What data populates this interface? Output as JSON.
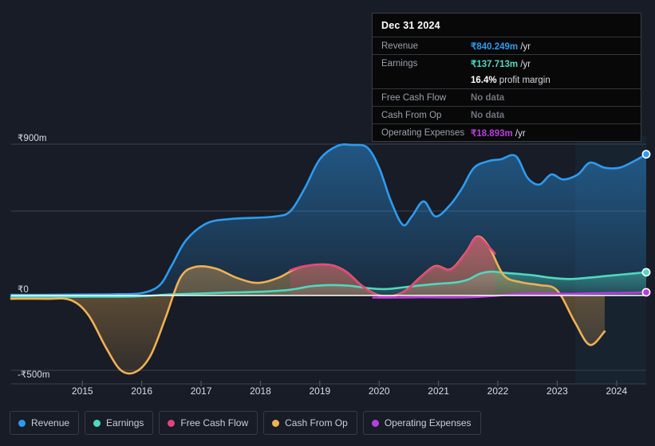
{
  "background_color": "#171c26",
  "tooltip": {
    "title": "Dec 31 2024",
    "rows": [
      {
        "key": "Revenue",
        "value": "₹840.249m",
        "unit": "/yr",
        "color": "#2e9bf0",
        "nodata": false
      },
      {
        "key": "Earnings",
        "value": "₹137.713m",
        "unit": "/yr",
        "color": "#4fd9c0",
        "nodata": false
      },
      {
        "key": "",
        "value": "16.4%",
        "unit": "profit margin",
        "color": "#ffffff",
        "nodata": false
      },
      {
        "key": "Free Cash Flow",
        "value": "No data",
        "unit": "",
        "color": "#6f747d",
        "nodata": true
      },
      {
        "key": "Cash From Op",
        "value": "No data",
        "unit": "",
        "color": "#6f747d",
        "nodata": true
      },
      {
        "key": "Operating Expenses",
        "value": "₹18.893m",
        "unit": "/yr",
        "color": "#b93ee0",
        "nodata": false
      }
    ]
  },
  "legend": {
    "items": [
      {
        "label": "Revenue",
        "color": "#2e9bf0"
      },
      {
        "label": "Earnings",
        "color": "#4fd9c0"
      },
      {
        "label": "Free Cash Flow",
        "color": "#e0457b"
      },
      {
        "label": "Cash From Op",
        "color": "#f0b055"
      },
      {
        "label": "Operating Expenses",
        "color": "#b93ee0"
      }
    ]
  },
  "chart_data": {
    "type": "area",
    "title": "",
    "xlabel": "",
    "ylabel": "",
    "currency": "₹",
    "units": "m",
    "grid": true,
    "legend_position": "bottom",
    "x_ticks": [
      "2015",
      "2016",
      "2017",
      "2018",
      "2019",
      "2020",
      "2021",
      "2022",
      "2023",
      "2024"
    ],
    "y_ticks": [
      "₹900m",
      "₹0",
      "-₹500m"
    ],
    "y_tick_values": [
      900,
      0,
      -500
    ],
    "ylim": [
      -560,
      960
    ],
    "xlim": [
      2014.3,
      2025.0
    ],
    "highlight_band": {
      "from": 2023.8,
      "to": 2025.0
    },
    "series": [
      {
        "name": "Revenue",
        "color": "#2e9bf0",
        "fill": true,
        "end_marker": true,
        "x": [
          2014.3,
          2014.8,
          2015.2,
          2015.7,
          2016.1,
          2016.5,
          2016.8,
          2017.0,
          2017.25,
          2017.6,
          2018.0,
          2018.4,
          2018.75,
          2019.0,
          2019.25,
          2019.5,
          2019.8,
          2020.05,
          2020.3,
          2020.5,
          2020.7,
          2020.9,
          2021.05,
          2021.25,
          2021.45,
          2021.7,
          2021.9,
          2022.1,
          2022.35,
          2022.55,
          2022.8,
          2023.0,
          2023.2,
          2023.4,
          2023.6,
          2023.85,
          2024.05,
          2024.3,
          2024.55,
          2024.8,
          2025.0
        ],
        "y": [
          4,
          4,
          5,
          6,
          8,
          14,
          60,
          175,
          330,
          430,
          455,
          462,
          470,
          500,
          640,
          810,
          890,
          895,
          880,
          760,
          560,
          420,
          470,
          560,
          470,
          540,
          640,
          760,
          800,
          810,
          830,
          700,
          660,
          720,
          690,
          720,
          790,
          760,
          760,
          800,
          840
        ]
      },
      {
        "name": "Earnings",
        "color": "#4fd9c0",
        "fill": true,
        "end_marker": true,
        "x": [
          2014.3,
          2015.0,
          2015.8,
          2016.4,
          2017.0,
          2017.5,
          2018.0,
          2018.5,
          2019.0,
          2019.35,
          2019.7,
          2020.0,
          2020.3,
          2020.6,
          2020.9,
          2021.2,
          2021.5,
          2021.8,
          2022.0,
          2022.2,
          2022.4,
          2022.6,
          2022.85,
          2023.1,
          2023.4,
          2023.7,
          2024.0,
          2024.3,
          2024.6,
          2025.0
        ],
        "y": [
          -8,
          -8,
          -8,
          -6,
          6,
          12,
          18,
          22,
          34,
          55,
          62,
          58,
          44,
          38,
          48,
          60,
          70,
          78,
          95,
          130,
          142,
          135,
          128,
          120,
          105,
          98,
          105,
          115,
          125,
          138
        ]
      },
      {
        "name": "Cash From Op",
        "color": "#f0b055",
        "fill": true,
        "end_marker": false,
        "x": [
          2014.3,
          2014.9,
          2015.3,
          2015.6,
          2015.9,
          2016.15,
          2016.4,
          2016.65,
          2016.9,
          2017.15,
          2017.4,
          2017.75,
          2018.1,
          2018.45,
          2018.8,
          2019.1,
          2019.4,
          2019.7,
          2019.95,
          2020.2,
          2020.45,
          2020.7,
          2020.95,
          2021.2,
          2021.45,
          2021.7,
          2021.95,
          2022.15,
          2022.35,
          2022.6,
          2022.9,
          2023.2,
          2023.5,
          2023.8,
          2024.05,
          2024.3
        ],
        "y": [
          -22,
          -22,
          -30,
          -130,
          -350,
          -500,
          -510,
          -400,
          -150,
          105,
          170,
          160,
          105,
          75,
          105,
          160,
          182,
          180,
          140,
          60,
          6,
          -5,
          30,
          110,
          175,
          155,
          250,
          350,
          290,
          120,
          78,
          62,
          30,
          -180,
          -330,
          -240
        ]
      },
      {
        "name": "Free Cash Flow",
        "color": "#e0457b",
        "fill": true,
        "end_marker": false,
        "x": [
          2019.0,
          2019.2,
          2019.45,
          2019.7,
          2019.95,
          2020.2,
          2020.45,
          2020.7,
          2020.95,
          2021.2,
          2021.45,
          2021.7,
          2021.95,
          2022.15,
          2022.35,
          2022.45
        ],
        "y": [
          150,
          172,
          182,
          178,
          138,
          58,
          4,
          -8,
          28,
          108,
          172,
          152,
          246,
          346,
          288,
          250
        ]
      },
      {
        "name": "Operating Expenses",
        "color": "#b93ee0",
        "fill": false,
        "end_marker": true,
        "x": [
          2020.4,
          2020.8,
          2021.2,
          2021.6,
          2022.0,
          2022.4,
          2022.8,
          2023.2,
          2023.6,
          2024.0,
          2024.4,
          2024.8,
          2025.0
        ],
        "y": [
          -14,
          -14,
          -12,
          -13,
          -12,
          -4,
          8,
          12,
          10,
          12,
          14,
          16,
          19
        ]
      }
    ]
  }
}
